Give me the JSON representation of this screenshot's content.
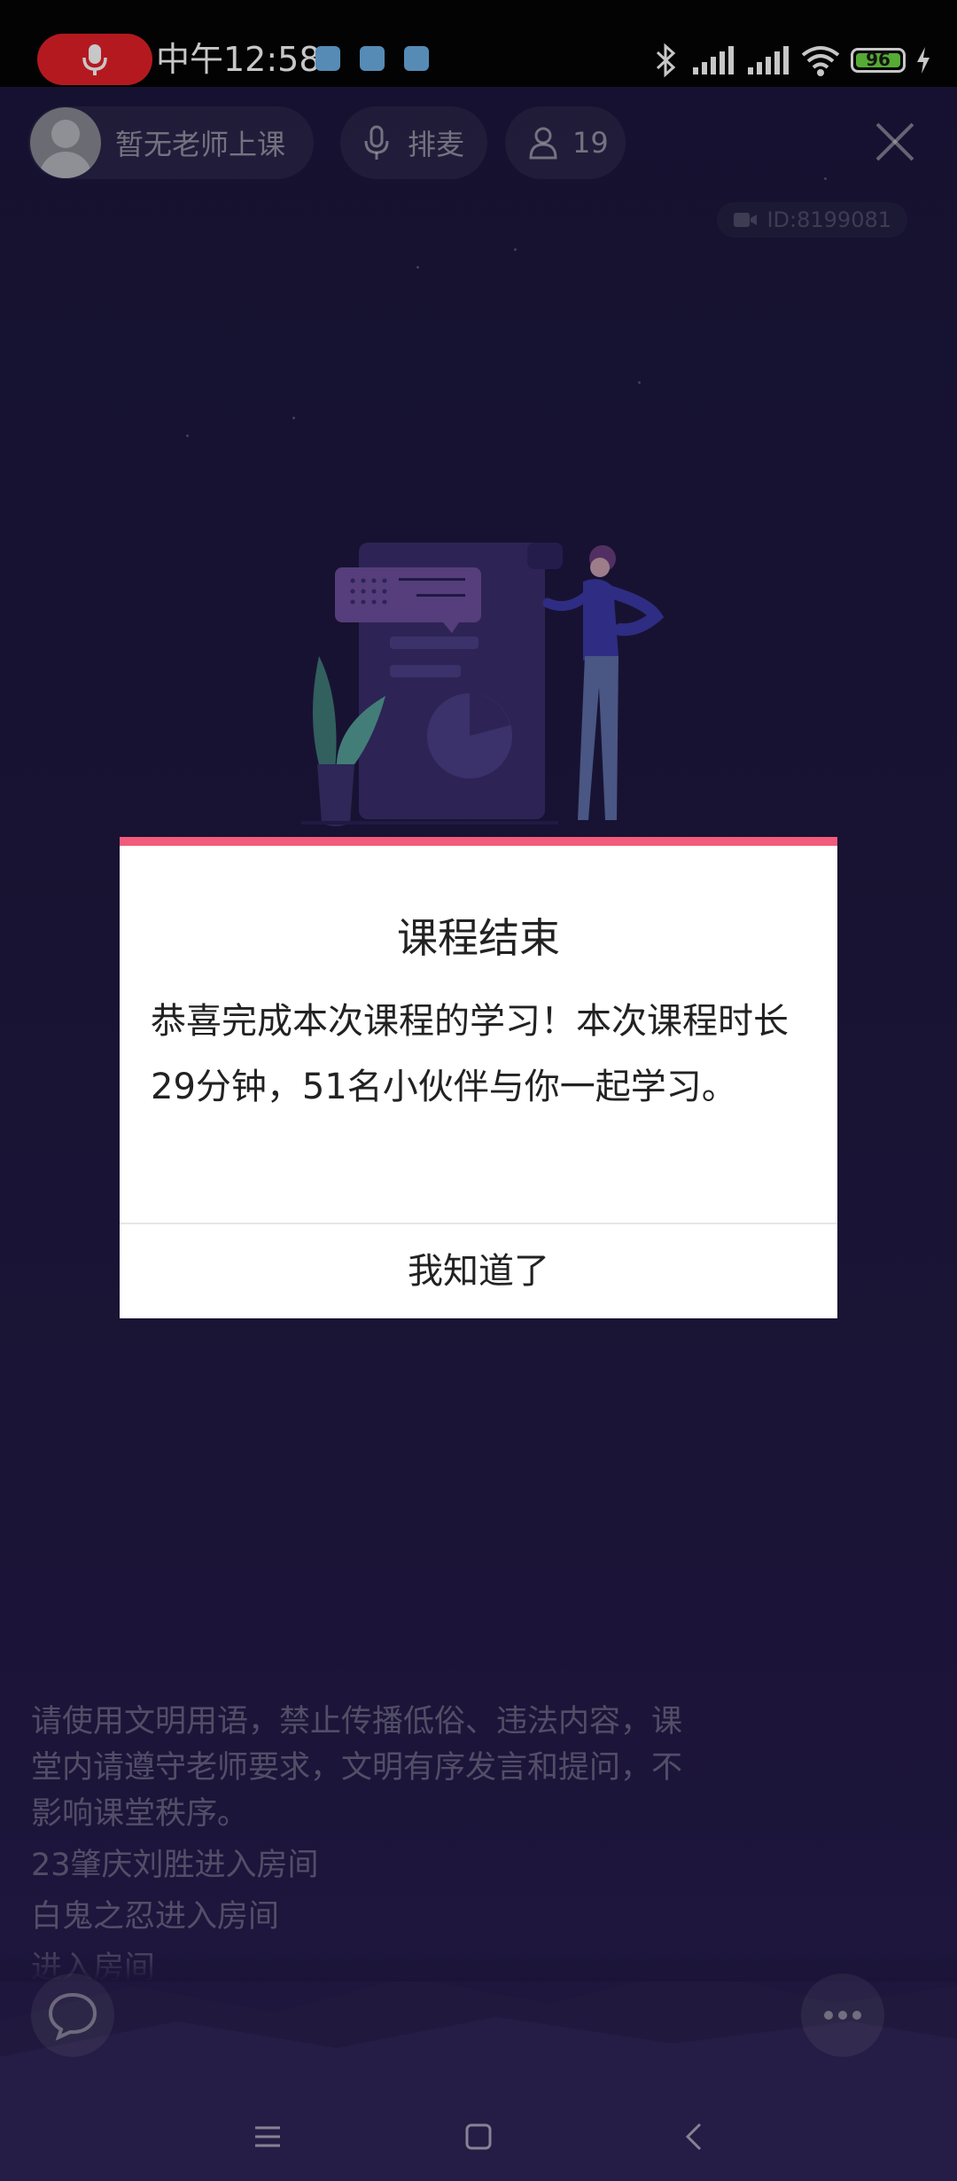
{
  "status_bar": {
    "time": "中午12:58",
    "battery": "96",
    "recording": true
  },
  "header": {
    "teacher_status": "暂无老师上课",
    "queue_label": "排麦",
    "online_count": "19",
    "room_id": "ID:8199081"
  },
  "dialog": {
    "title": "课程结束",
    "message": "恭喜完成本次课程的学习！本次课程时长29分钟，51名小伙伴与你一起学习。",
    "confirm_label": "我知道了"
  },
  "chat": {
    "messages": [
      "请使用文明用语，禁止传播低俗、违法内容，课堂内请遵守老师要求，文明有序发言和提问，不影响课堂秩序。",
      "23肇庆刘胜进入房间",
      "白鬼之忍进入房间",
      "进入房间"
    ]
  },
  "colors": {
    "background": "#1c173c",
    "dialog_accent": "#f25b7c",
    "record_pill": "#e8202a",
    "battery": "#6ddc44"
  },
  "icons": [
    "mic-icon",
    "bluetooth-icon",
    "signal-icon",
    "wifi-icon",
    "battery-icon",
    "charging-icon",
    "microphone-icon",
    "person-icon",
    "close-icon",
    "camera-icon",
    "chat-bubble-icon",
    "more-icon",
    "menu-icon",
    "home-icon",
    "back-icon"
  ]
}
